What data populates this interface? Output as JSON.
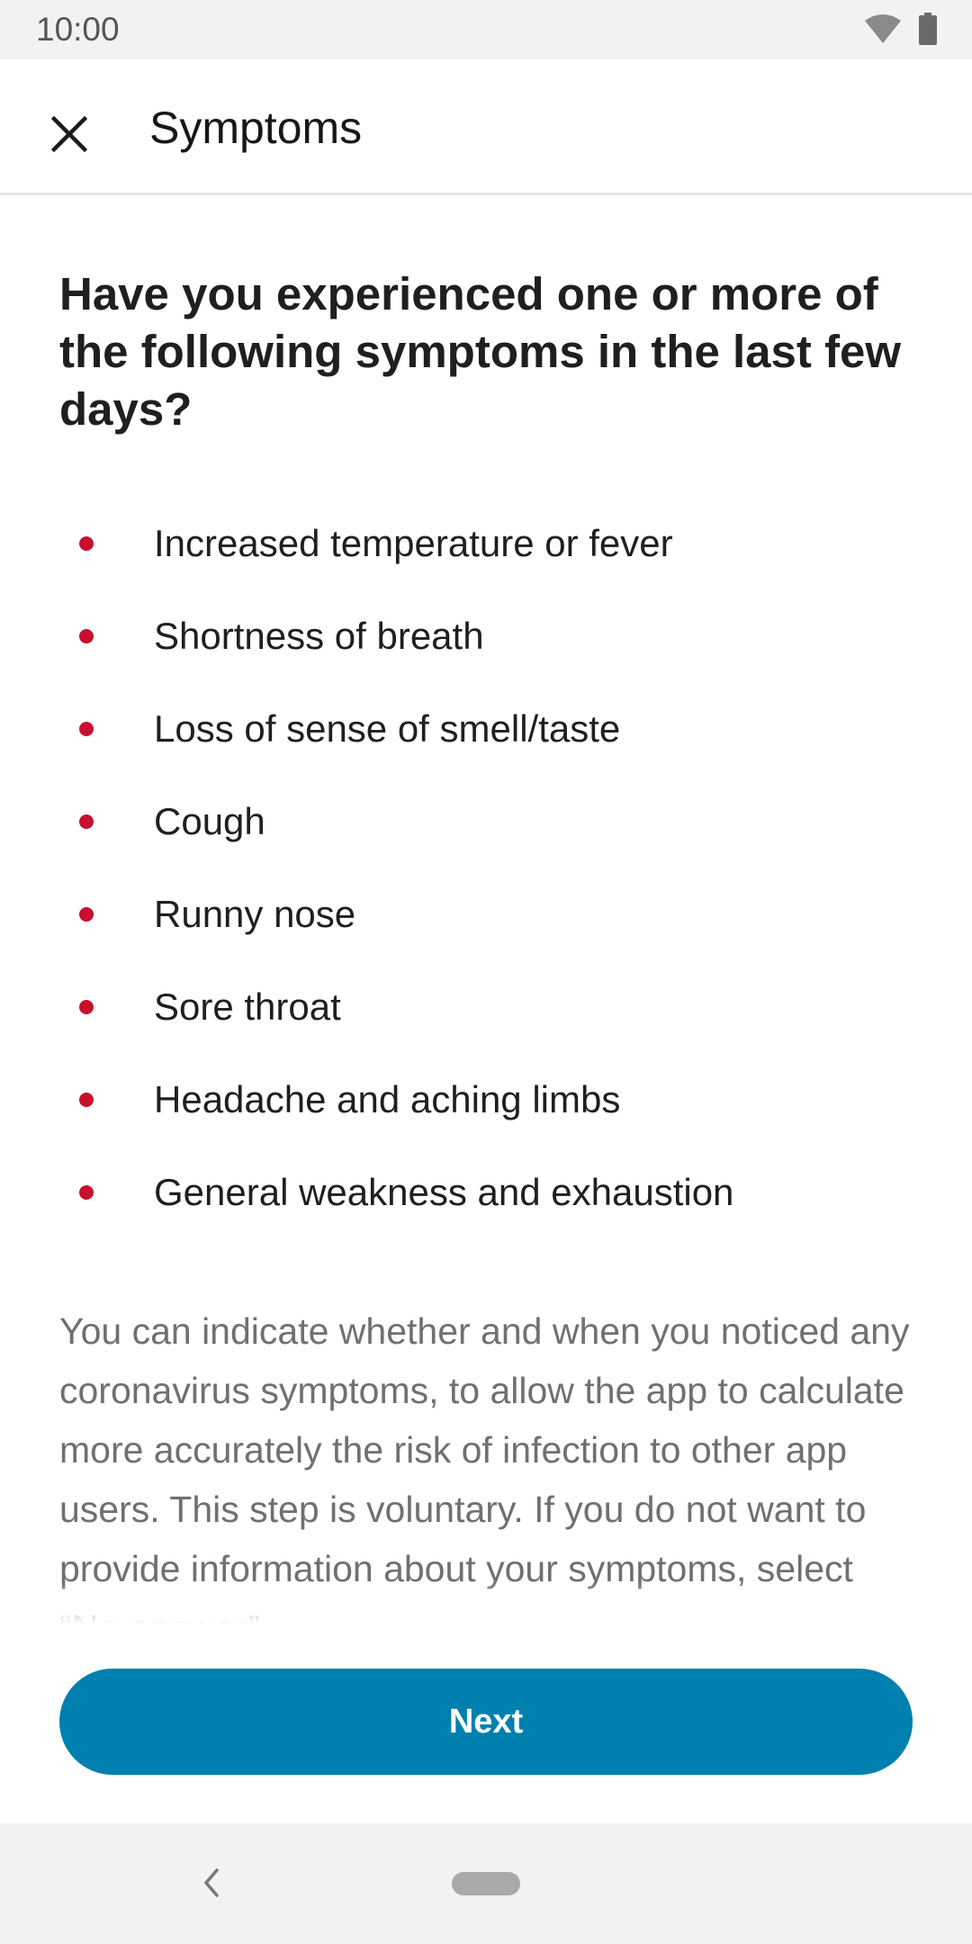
{
  "status_bar": {
    "time": "10:00",
    "icons": [
      "wifi-icon",
      "battery-icon"
    ]
  },
  "app_bar": {
    "title": "Symptoms",
    "close_icon": "close-icon"
  },
  "content": {
    "heading": "Have you experienced one or more of the following symptoms in the last few days?",
    "symptoms": [
      "Increased temperature or fever",
      "Shortness of breath",
      "Loss of sense of smell/taste",
      "Cough",
      "Runny nose",
      "Sore throat",
      "Headache and aching limbs",
      "General weakness and exhaustion"
    ],
    "info": "You can indicate whether and when you noticed any coronavirus symptoms, to allow the app to calculate more accurately the risk of infection to other app users. This step is voluntary. If you do not want to provide information about your symptoms, select “No answer”."
  },
  "actions": {
    "next_label": "Next"
  },
  "nav_bar": {
    "back_icon": "back-chevron-icon",
    "home_icon": "home-pill-icon"
  },
  "colors": {
    "accent": "#0080ae",
    "bullet": "#c8102e",
    "heading_text": "#1f1f1f",
    "info_text": "#707070"
  }
}
